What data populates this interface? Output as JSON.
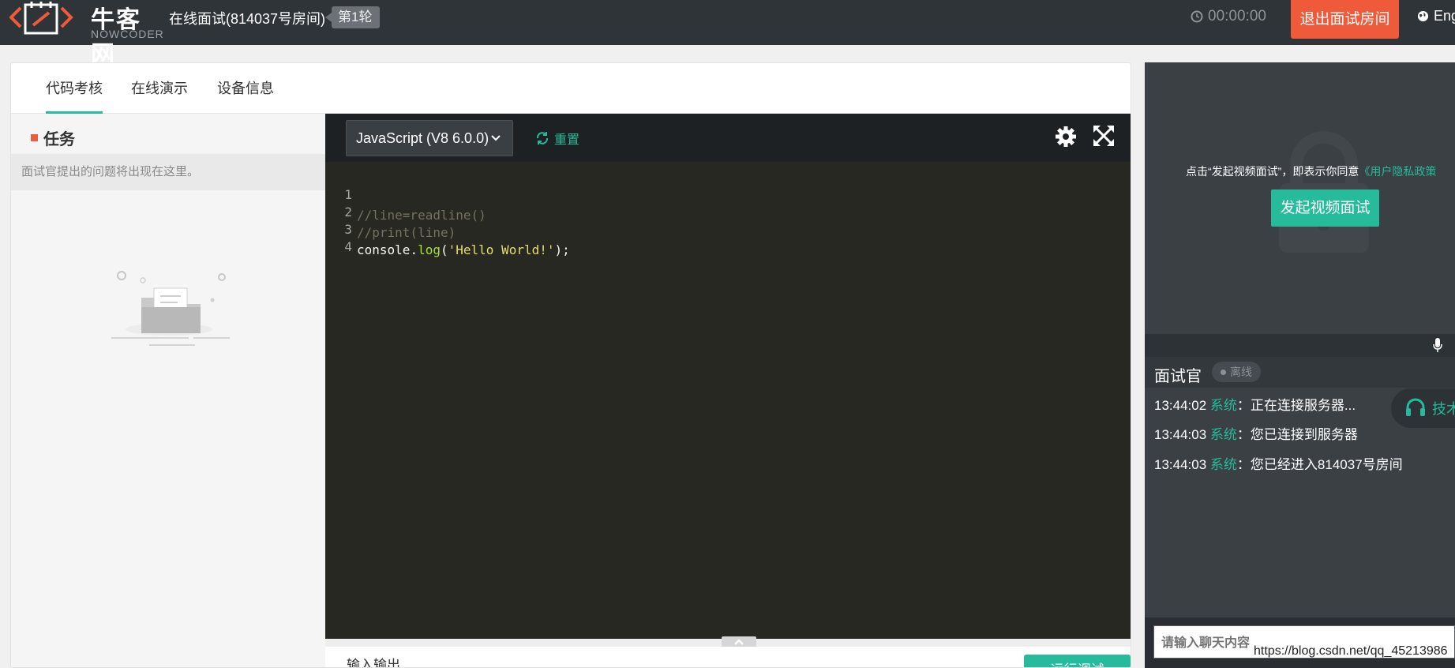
{
  "header": {
    "brand": "牛客网",
    "brand_sub": "NOWCODER",
    "room_title": "在线面试(814037号房间)",
    "round": "第1轮",
    "timer": "00:00:00",
    "exit_label": "退出面试房间",
    "language_label": "Eng"
  },
  "tabs": [
    {
      "label": "代码考核",
      "active": true
    },
    {
      "label": "在线演示",
      "active": false
    },
    {
      "label": "设备信息",
      "active": false
    }
  ],
  "task": {
    "title": "任务",
    "hint": "面试官提出的问题将出现在这里。"
  },
  "editor": {
    "language": "JavaScript (V8 6.0.0)",
    "reset_label": "重置",
    "lines": [
      {
        "num": "1",
        "text": "//line=readline()"
      },
      {
        "num": "2",
        "text": "//print(line)"
      },
      {
        "num": "3",
        "text": "console.log('Hello World!');"
      },
      {
        "num": "4",
        "text": ""
      }
    ]
  },
  "bottom": {
    "label": "输入输出",
    "run_label": "运行调试"
  },
  "video": {
    "notice_prefix": "点击“发起视频面试”，即表示你同意",
    "notice_link": "《用户隐私政策",
    "start_label": "发起视频面试"
  },
  "chat": {
    "title": "面试官",
    "status": "离线",
    "support_label": "技术",
    "messages": [
      {
        "time": "13:44:02",
        "sender": "系统",
        "text": "：正在连接服务器..."
      },
      {
        "time": "13:44:03",
        "sender": "系统",
        "text": "：您已连接到服务器"
      },
      {
        "time": "13:44:03",
        "sender": "系统",
        "text": "：您已经进入814037号房间"
      }
    ],
    "input_placeholder": "请输入聊天内容"
  },
  "watermark": "https://blog.csdn.net/qq_45213986",
  "colors": {
    "accent": "#25bb9b",
    "danger": "#ef5a3a",
    "header_bg": "#2f3438",
    "editor_bg": "#272822"
  }
}
